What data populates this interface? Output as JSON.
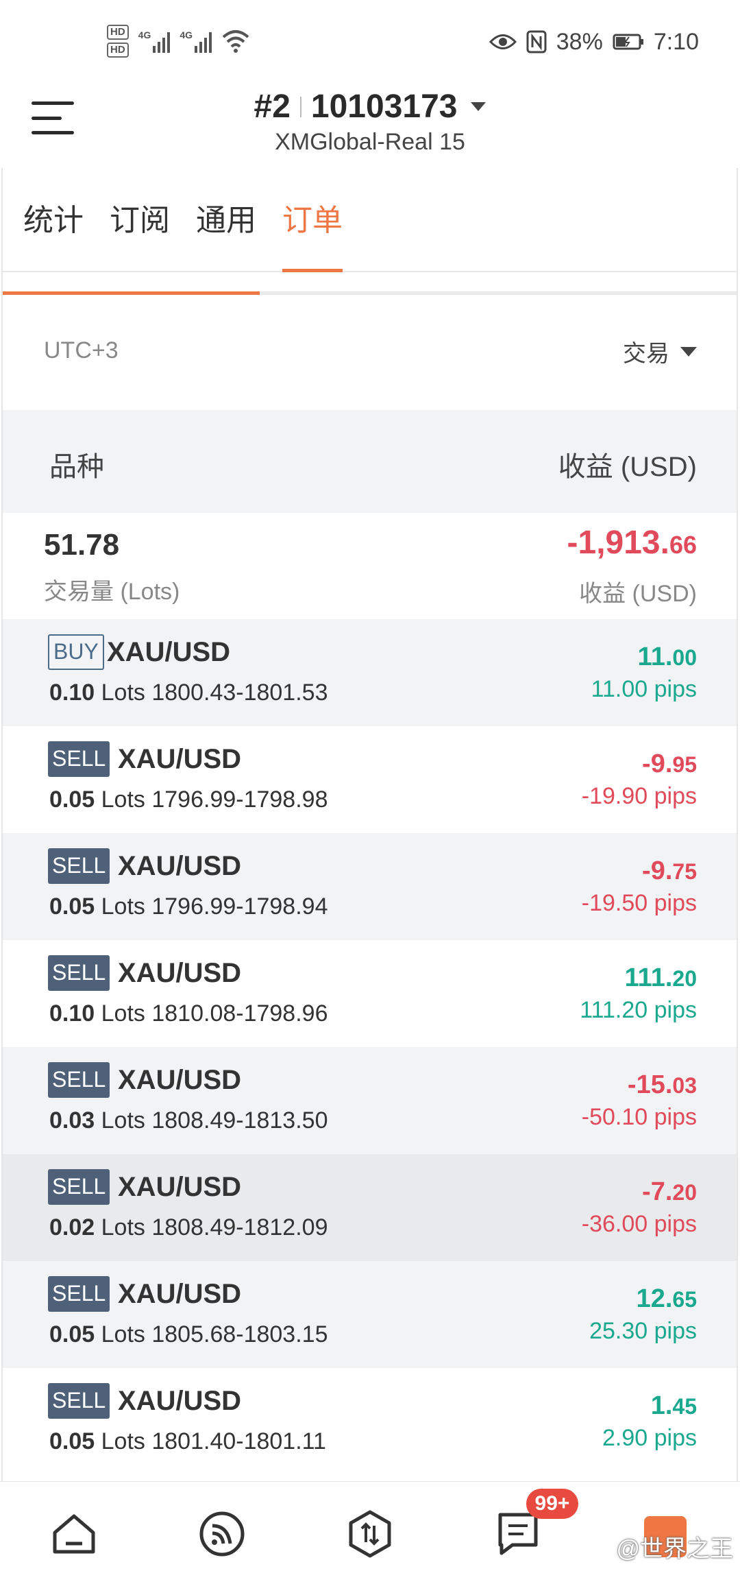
{
  "status_bar": {
    "hd1": "HD",
    "hd2": "HD",
    "sig1_label": "4G",
    "sig2_label": "4G",
    "battery": "38%",
    "time": "7:10"
  },
  "header": {
    "account_index": "#2",
    "account_number": "10103173",
    "server": "XMGlobal-Real 15"
  },
  "tabs": [
    {
      "label": "统计",
      "active": false
    },
    {
      "label": "订阅",
      "active": false
    },
    {
      "label": "通用",
      "active": false
    },
    {
      "label": "订单",
      "active": true
    }
  ],
  "scroll_progress": 0.35,
  "filter": {
    "timezone": "UTC+3",
    "type": "交易"
  },
  "columns": {
    "left": "品种",
    "right": "收益 (USD)"
  },
  "summary": {
    "volume": "51.78",
    "volume_label": "交易量 (Lots)",
    "profit_int": "-1,913.",
    "profit_dec": "66",
    "profit_label": "收益 (USD)"
  },
  "orders": [
    {
      "side": "BUY",
      "symbol": "XAU/USD",
      "lots": "0.10",
      "lots_unit": "Lots",
      "prices": "1800.43-1801.53",
      "profit_int": "11.",
      "profit_dec": "00",
      "pips": "11.00 pips",
      "sign": "pos"
    },
    {
      "side": "SELL",
      "symbol": "XAU/USD",
      "lots": "0.05",
      "lots_unit": "Lots",
      "prices": "1796.99-1798.98",
      "profit_int": "-9.",
      "profit_dec": "95",
      "pips": "-19.90 pips",
      "sign": "neg"
    },
    {
      "side": "SELL",
      "symbol": "XAU/USD",
      "lots": "0.05",
      "lots_unit": "Lots",
      "prices": "1796.99-1798.94",
      "profit_int": "-9.",
      "profit_dec": "75",
      "pips": "-19.50 pips",
      "sign": "neg"
    },
    {
      "side": "SELL",
      "symbol": "XAU/USD",
      "lots": "0.10",
      "lots_unit": "Lots",
      "prices": "1810.08-1798.96",
      "profit_int": "111.",
      "profit_dec": "20",
      "pips": "111.20 pips",
      "sign": "pos"
    },
    {
      "side": "SELL",
      "symbol": "XAU/USD",
      "lots": "0.03",
      "lots_unit": "Lots",
      "prices": "1808.49-1813.50",
      "profit_int": "-15.",
      "profit_dec": "03",
      "pips": "-50.10 pips",
      "sign": "neg"
    },
    {
      "side": "SELL",
      "symbol": "XAU/USD",
      "lots": "0.02",
      "lots_unit": "Lots",
      "prices": "1808.49-1812.09",
      "profit_int": "-7.",
      "profit_dec": "20",
      "pips": "-36.00 pips",
      "sign": "neg"
    },
    {
      "side": "SELL",
      "symbol": "XAU/USD",
      "lots": "0.05",
      "lots_unit": "Lots",
      "prices": "1805.68-1803.15",
      "profit_int": "12.",
      "profit_dec": "65",
      "pips": "25.30 pips",
      "sign": "pos"
    },
    {
      "side": "SELL",
      "symbol": "XAU/USD",
      "lots": "0.05",
      "lots_unit": "Lots",
      "prices": "1801.40-1801.11",
      "profit_int": "1.",
      "profit_dec": "45",
      "pips": "2.90 pips",
      "sign": "pos"
    }
  ],
  "bottom_nav": {
    "items": [
      "home-icon",
      "signal-icon",
      "trade-icon",
      "messages-icon",
      "app-icon"
    ],
    "badge": "99+",
    "watermark": "@世界之王"
  },
  "colors": {
    "accent": "#ee7744",
    "positive": "#1aa88e",
    "negative": "#e04a5a",
    "sell_badge": "#4e6178"
  }
}
